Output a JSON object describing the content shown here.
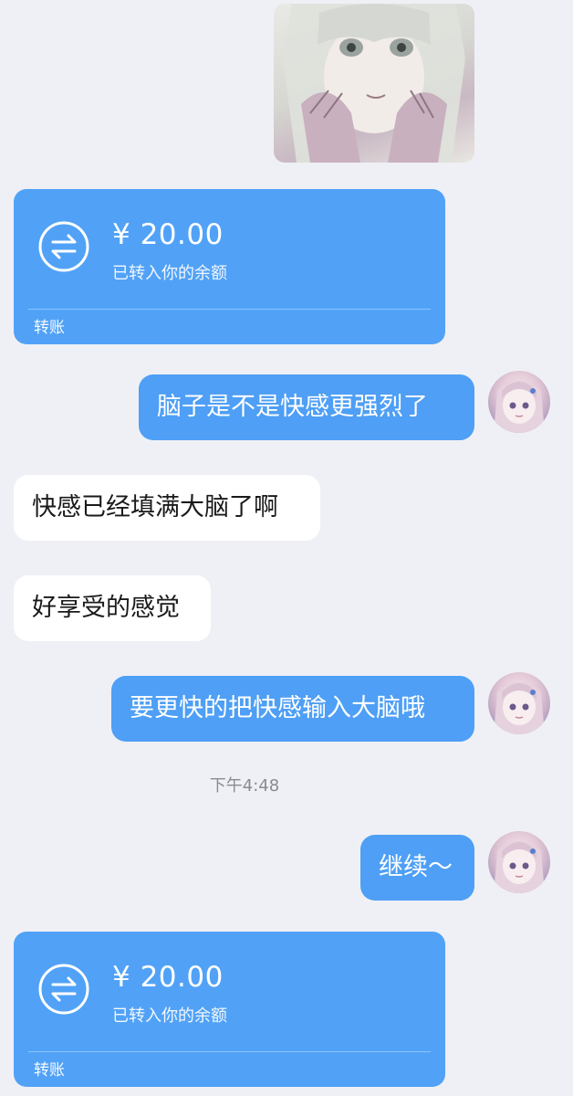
{
  "chat": {
    "transfer_1": {
      "amount": "¥ 20.00",
      "status": "已转入你的余额",
      "label": "转账"
    },
    "msg_1": "脑子是不是快感更强烈了",
    "msg_2": "快感已经填满大脑了啊",
    "msg_3": "好享受的感觉",
    "msg_4": "要更快的把快感输入大脑哦",
    "timestamp": "下午4:48",
    "msg_5": "继续～",
    "transfer_2": {
      "amount": "¥ 20.00",
      "status": "已转入你的余额",
      "label": "转账"
    }
  },
  "colors": {
    "background": "#eff0f5",
    "bubble_self": "#4e9ff5",
    "transfer_card": "#51a2f7",
    "bubble_other": "#ffffff"
  },
  "icons": {
    "transfer": "transfer-arrows-icon"
  }
}
